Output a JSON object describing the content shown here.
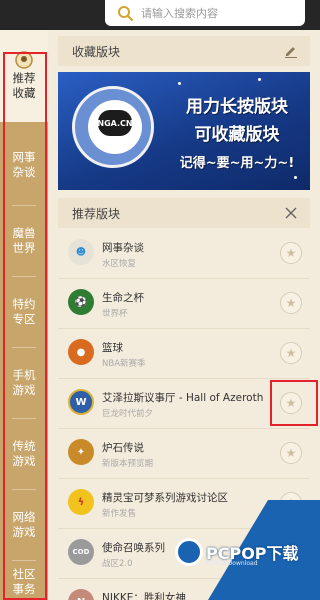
{
  "search": {
    "placeholder": "请输入搜索内容"
  },
  "sidebar": {
    "items": [
      {
        "label_line1": "推荐",
        "label_line2": "收藏"
      },
      {
        "label_line1": "网事",
        "label_line2": "杂谈"
      },
      {
        "label_line1": "魔兽",
        "label_line2": "世界"
      },
      {
        "label_line1": "特约",
        "label_line2": "专区"
      },
      {
        "label_line1": "手机",
        "label_line2": "游戏"
      },
      {
        "label_line1": "传统",
        "label_line2": "游戏"
      },
      {
        "label_line1": "网络",
        "label_line2": "游戏"
      },
      {
        "label_line1": "社区",
        "label_line2": "事务"
      }
    ]
  },
  "favorites": {
    "title": "收藏版块"
  },
  "banner": {
    "site": "NGA.CN",
    "line1": "用力长按版块",
    "line2": "可收藏版块",
    "line3": "记得~要~用~力~!"
  },
  "recommended": {
    "title": "推荐版块",
    "rows": [
      {
        "name": "网事杂谈",
        "sub": "水区恢复",
        "icon": "mascot-icon",
        "color": "#e6e2d8"
      },
      {
        "name": "生命之杯",
        "sub": "世界杯",
        "icon": "soccer-ball-icon",
        "color": "#2e7d32"
      },
      {
        "name": "篮球",
        "sub": "NBA新赛季",
        "icon": "basketball-icon",
        "color": "#d86b1f"
      },
      {
        "name": "艾泽拉斯议事厅 - Hall of Azeroth",
        "sub": "巨龙时代前夕",
        "icon": "warcraft-logo-icon",
        "color": "#2f5fa8"
      },
      {
        "name": "炉石传说",
        "sub": "新版本预览期",
        "icon": "hearthstone-icon",
        "color": "#c98a2a"
      },
      {
        "name": "精灵宝可梦系列游戏讨论区",
        "sub": "新作发售",
        "icon": "pikachu-icon",
        "color": "#f2c21d"
      },
      {
        "name": "使命召唤系列",
        "sub": "战区2.0",
        "icon": "call-of-duty-icon",
        "color": "#9a9a9a"
      },
      {
        "name": "NIKKE：胜利女神",
        "sub": "",
        "icon": "nikke-icon",
        "color": "#c48a7a"
      }
    ]
  },
  "watermark": {
    "brand": "PCPOP下载",
    "sub": "PCPOP Download"
  },
  "colors": {
    "sidebar": "#c8a66b",
    "panel": "#f3ebdc",
    "highlight": "#e2232a"
  }
}
